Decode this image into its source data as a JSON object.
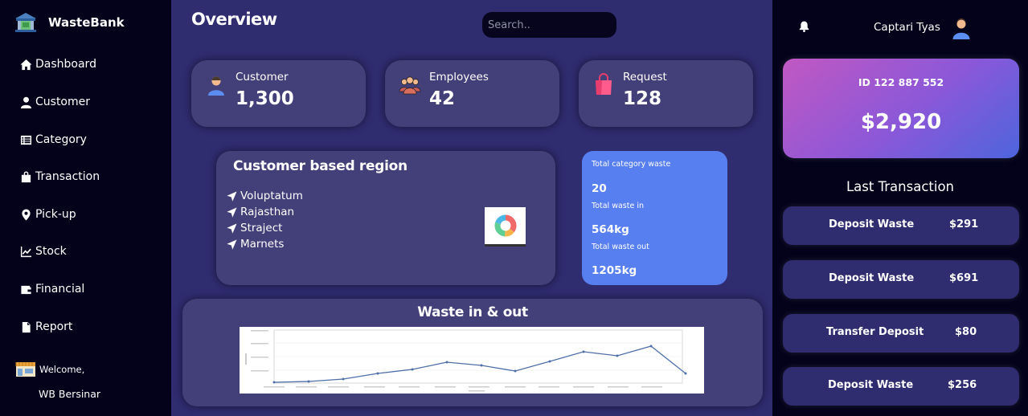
{
  "app": {
    "name": "WasteBank"
  },
  "sidebar": {
    "items": [
      {
        "label": "Dashboard",
        "icon": "home-icon"
      },
      {
        "label": "Customer",
        "icon": "user-icon"
      },
      {
        "label": "Category",
        "icon": "list-icon"
      },
      {
        "label": "Transaction",
        "icon": "shopping-bag-icon"
      },
      {
        "label": "Pick-up",
        "icon": "map-marker-icon"
      },
      {
        "label": "Stock",
        "icon": "line-chart-icon"
      },
      {
        "label": "Financial",
        "icon": "wallet-icon"
      },
      {
        "label": "Report",
        "icon": "file-icon"
      }
    ],
    "welcome": {
      "label": "Welcome,",
      "name": "WB Bersinar"
    }
  },
  "header": {
    "title": "Overview",
    "search_placeholder": "Search.."
  },
  "stats": [
    {
      "label": "Customer",
      "value": "1,300",
      "icon": "customer-icon"
    },
    {
      "label": "Employees",
      "value": "42",
      "icon": "employees-icon"
    },
    {
      "label": "Request",
      "value": "128",
      "icon": "shopping-bag-icon"
    }
  ],
  "region": {
    "title": "Customer based region",
    "items": [
      "Voluptatum",
      "Rajasthan",
      "Straject",
      "Marnets"
    ]
  },
  "waste_summary": {
    "total_category_label": "Total category waste",
    "total_category_value": "20",
    "total_in_label": "Total waste in",
    "total_in_value": "564kg",
    "total_out_label": "Total waste out",
    "total_out_value": "1205kg"
  },
  "waste_chart": {
    "title": "Waste in & out",
    "line_color": "#4e6fa8"
  },
  "user": {
    "name": "Captari Tyas"
  },
  "balance": {
    "id": "ID 122 887 552",
    "amount": "$2,920"
  },
  "last_transaction": {
    "title": "Last Transaction",
    "items": [
      {
        "name": "Deposit Waste",
        "amount": "$291"
      },
      {
        "name": "Deposit Waste",
        "amount": "$691"
      },
      {
        "name": "Transfer Deposit",
        "amount": "$80"
      },
      {
        "name": "Deposit Waste",
        "amount": "$256"
      }
    ]
  },
  "colors": {
    "sidebar_bg": "#03021a",
    "main_bg": "#2f2c70",
    "card_bg": "#433f78",
    "waste_card_bg": "#587ff0",
    "balance_gradient_start": "#c158c2",
    "balance_gradient_end": "#4d65dc"
  }
}
